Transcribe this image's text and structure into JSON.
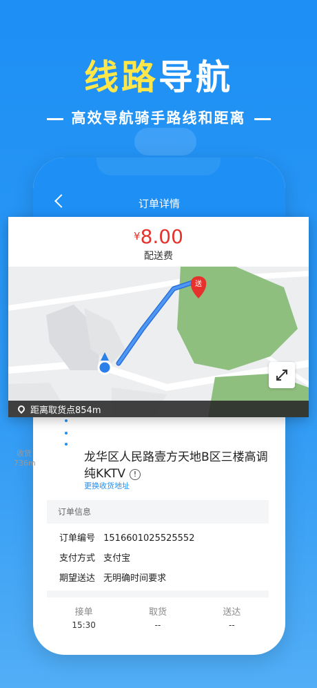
{
  "hero": {
    "title_accent": "线路",
    "title_rest": "导航",
    "subtitle": "高效导航骑手路线和距离"
  },
  "nav": {
    "title": "订单详情"
  },
  "fee": {
    "currency": "¥",
    "amount": "8.00",
    "label": "配送费"
  },
  "map": {
    "marker_label": "送",
    "distance_text": "距离取货点854m"
  },
  "delivery": {
    "recv_label": "收货",
    "recv_distance": "736m",
    "address": "龙华区人民路壹方天地B区三楼高调纯KKTV",
    "info_icon": "!",
    "change_link": "更换收货地址"
  },
  "order_info": {
    "section_title": "订单信息",
    "rows": [
      {
        "key": "订单编号",
        "value": "1516601025525552"
      },
      {
        "key": "支付方式",
        "value": "支付宝"
      },
      {
        "key": "期望送达",
        "value": "无明确时间要求"
      }
    ]
  },
  "steps": [
    {
      "label": "接单",
      "value": "15:30"
    },
    {
      "label": "取货",
      "value": "--"
    },
    {
      "label": "送达",
      "value": "--"
    }
  ],
  "colors": {
    "brand_blue": "#1e90f5",
    "fee_red": "#e5322d",
    "accent_yellow": "#ffe74a"
  }
}
